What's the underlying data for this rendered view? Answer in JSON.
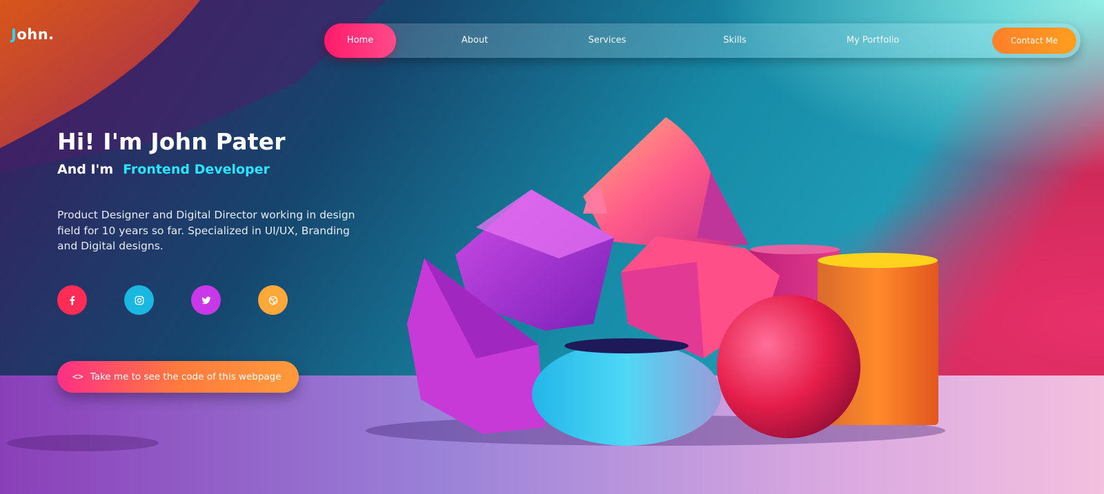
{
  "logo": {
    "initial": "J",
    "rest": "ohn."
  },
  "nav": {
    "items": [
      {
        "label": "Home",
        "active": true
      },
      {
        "label": "About"
      },
      {
        "label": "Services"
      },
      {
        "label": "Skills"
      },
      {
        "label": "My Portfolio"
      }
    ],
    "contact_label": "Contact Me"
  },
  "hero": {
    "title": "Hi! I'm John Pater",
    "subtitle_prefix": "And I'm",
    "role": "Frontend Developer",
    "description": "Product Designer and Digital Director working in design field for 10 years so far. Specialized in UI/UX, Branding and Digital designs."
  },
  "socials": [
    {
      "icon": "facebook-icon",
      "color": "#ff2d55"
    },
    {
      "icon": "instagram-icon",
      "color": "#1ab8e0"
    },
    {
      "icon": "twitter-icon",
      "color": "#c837e8"
    },
    {
      "icon": "dribbble-icon",
      "color": "#ffa83a"
    }
  ],
  "cta": {
    "icon": "code-icon",
    "label": "Take me to see the code of this webpage"
  },
  "colors": {
    "accent_cyan": "#29e6ff",
    "active_pink": "#ff1a6a",
    "contact_orange": "#ff8a24"
  }
}
